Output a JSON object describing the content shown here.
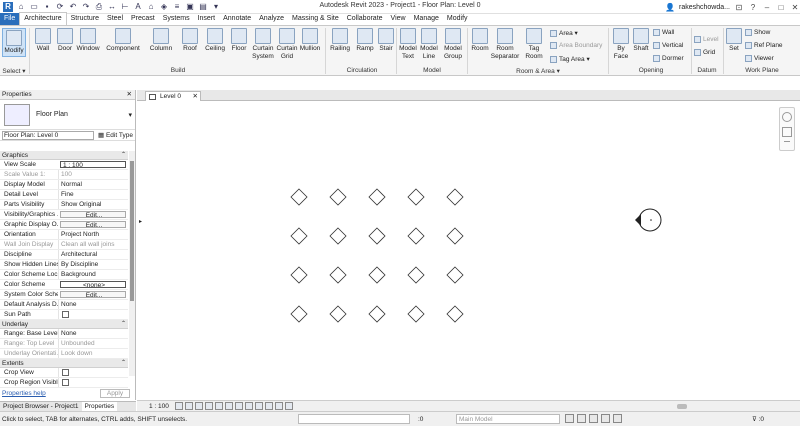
{
  "window": {
    "title": "Autodesk Revit 2023 - Project1 - Floor Plan: Level 0",
    "user": "rakeshchowda..."
  },
  "tabs": [
    "File",
    "Architecture",
    "Structure",
    "Steel",
    "Precast",
    "Systems",
    "Insert",
    "Annotate",
    "Analyze",
    "Massing & Site",
    "Collaborate",
    "View",
    "Manage",
    "Modify"
  ],
  "ribbon": {
    "modify": "Modify",
    "select": "Select ▾",
    "build_buttons": [
      "Wall",
      "Door",
      "Window",
      "Component",
      "Column",
      "Roof",
      "Ceiling",
      "Floor",
      "Curtain System",
      "Curtain Grid",
      "Mullion"
    ],
    "circulation_buttons": [
      "Railing",
      "Ramp",
      "Stair"
    ],
    "model_buttons": [
      "Model Text",
      "Model Line",
      "Model Group"
    ],
    "room_buttons": [
      "Room",
      "Room Separator",
      "Tag Room"
    ],
    "room_small": [
      "Area ▾",
      "Area Boundary",
      "Tag Area ▾"
    ],
    "opening_buttons": [
      "By Face",
      "Shaft"
    ],
    "opening_small": [
      "Wall",
      "Vertical",
      "Dormer"
    ],
    "datum_small": [
      "Level",
      "Grid"
    ],
    "workplane_set": "Set",
    "workplane_small": [
      "Show",
      "Ref Plane",
      "Viewer"
    ],
    "groups": [
      "Select ▾",
      "Build",
      "Circulation",
      "Model",
      "Room & Area ▾",
      "Opening",
      "Datum",
      "Work Plane"
    ]
  },
  "properties": {
    "title": "Properties",
    "type_name": "Floor Plan",
    "instance": "Floor Plan: Level 0",
    "edit_type": "Edit Type",
    "categories": {
      "graphics": "Graphics",
      "underlay": "Underlay",
      "extents": "Extents"
    },
    "graphics_rows": [
      {
        "k": "View Scale",
        "v": "1 : 100"
      },
      {
        "k": "Scale Value    1:",
        "v": "100"
      },
      {
        "k": "Display Model",
        "v": "Normal"
      },
      {
        "k": "Detail Level",
        "v": "Fine"
      },
      {
        "k": "Parts Visibility",
        "v": "Show Original"
      },
      {
        "k": "Visibility/Graphics ...",
        "v": "Edit..."
      },
      {
        "k": "Graphic Display O...",
        "v": "Edit..."
      },
      {
        "k": "Orientation",
        "v": "Project North"
      },
      {
        "k": "Wall Join Display",
        "v": "Clean all wall joins"
      },
      {
        "k": "Discipline",
        "v": "Architectural"
      },
      {
        "k": "Show Hidden Lines",
        "v": "By Discipline"
      },
      {
        "k": "Color Scheme Loc...",
        "v": "Background"
      },
      {
        "k": "Color Scheme",
        "v": "<none>"
      },
      {
        "k": "System Color Sche...",
        "v": "Edit..."
      },
      {
        "k": "Default Analysis D...",
        "v": "None"
      },
      {
        "k": "Sun Path",
        "v": ""
      }
    ],
    "underlay_rows": [
      {
        "k": "Range: Base Level",
        "v": "None"
      },
      {
        "k": "Range: Top Level",
        "v": "Unbounded"
      },
      {
        "k": "Underlay Orientati...",
        "v": "Look down"
      }
    ],
    "extents_rows": [
      {
        "k": "Crop View",
        "v": ""
      },
      {
        "k": "Crop Region Visible",
        "v": ""
      }
    ],
    "help": "Properties help",
    "apply": "Apply"
  },
  "bottom_tabs": [
    "Project Browser - Project1",
    "Properties"
  ],
  "view_tab": "Level 0",
  "view_scale": "1 : 100",
  "status": {
    "message": "Click to select, TAB for alternates, CTRL adds, SHIFT unselects.",
    "zero": ":0",
    "model": "Main Model",
    "filter": ":0"
  },
  "grid": {
    "cols": 5,
    "rows": 4
  }
}
